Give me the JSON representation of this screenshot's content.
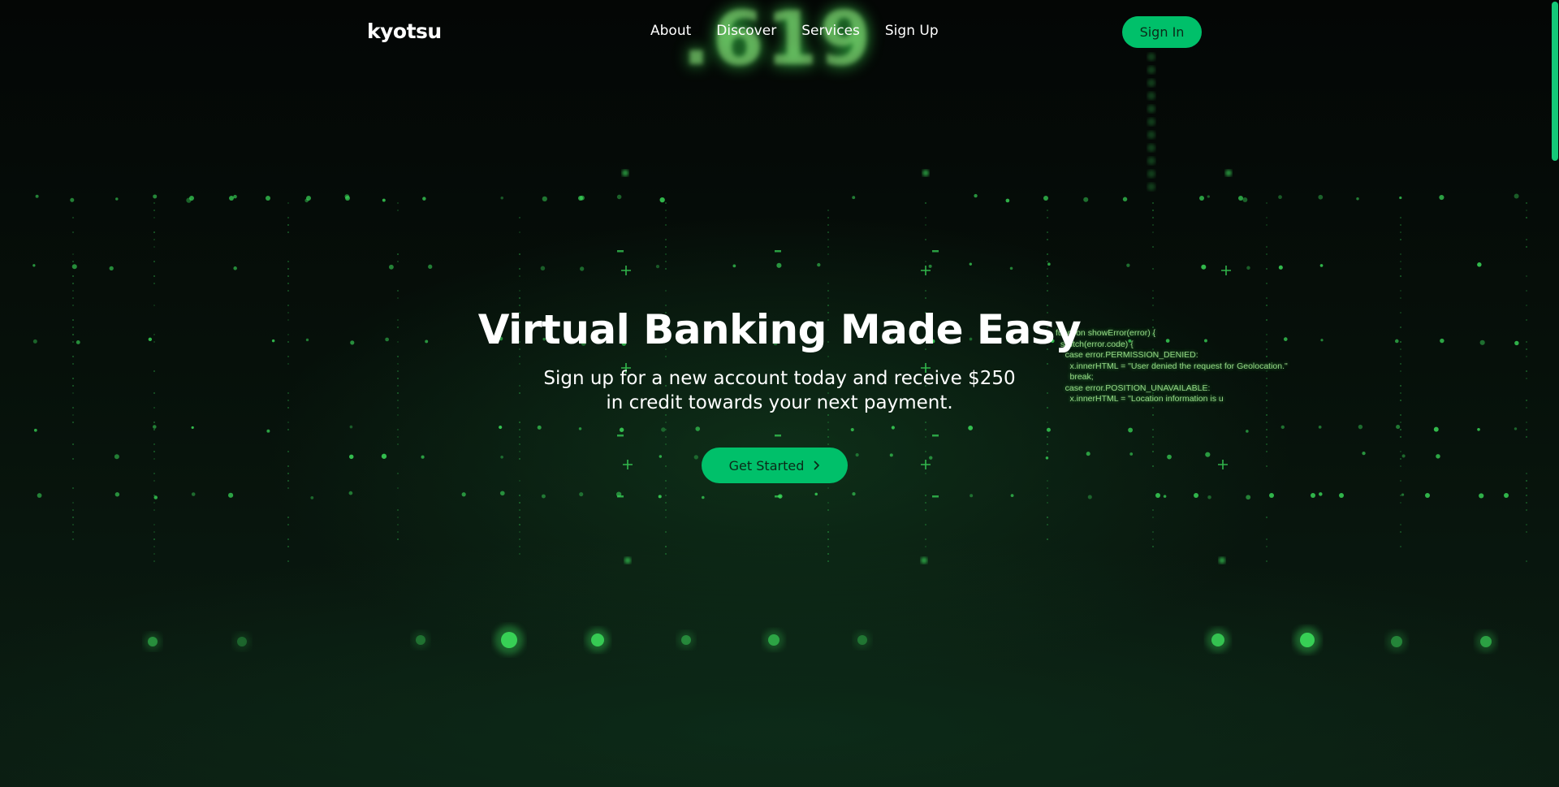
{
  "brand": {
    "name": "kyotsu"
  },
  "nav": {
    "links": [
      "About",
      "Discover",
      "Services",
      "Sign Up"
    ],
    "signin_label": "Sign In"
  },
  "hero": {
    "title": "Virtual Banking Made Easy",
    "subtitle_line1": "Sign up for a new account today and receive $250",
    "subtitle_line2": "in credit towards your next payment.",
    "cta_label": "Get Started",
    "cta_icon": "chevron-right-icon"
  },
  "background": {
    "number_text": ".619",
    "code_lines": [
      "function showError(error) {",
      "  switch(error.code) {",
      "    case error.PERMISSION_DENIED:",
      "      x.innerHTML = \"User denied the request for Geolocation.\"",
      "      break;",
      "    case error.POSITION_UNAVAILABLE:",
      "      x.innerHTML = \"Location information is u"
    ]
  },
  "colors": {
    "accent": "#00c06a",
    "background": "#050807",
    "glow": "#3bdc5a"
  }
}
